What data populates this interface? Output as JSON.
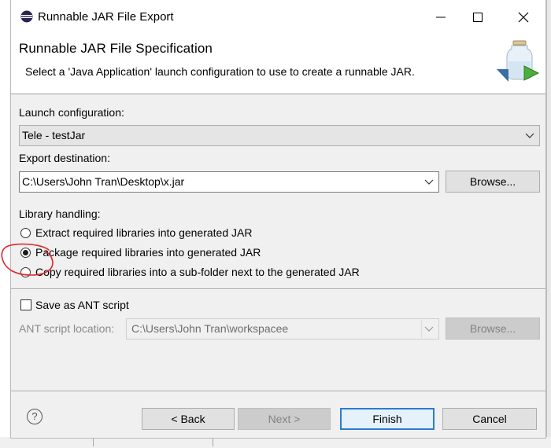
{
  "window": {
    "title": "Runnable JAR File Export"
  },
  "banner": {
    "title": "Runnable JAR File Specification",
    "description": "Select a 'Java Application' launch configuration to use to create a runnable JAR."
  },
  "launch": {
    "label": "Launch configuration:",
    "value": "Tele - testJar"
  },
  "export": {
    "label": "Export destination:",
    "value": "C:\\Users\\John Tran\\Desktop\\x.jar",
    "browse_label": "Browse..."
  },
  "library": {
    "label": "Library handling:",
    "options": [
      {
        "label": "Extract required libraries into generated JAR",
        "selected": false
      },
      {
        "label": "Package required libraries into generated JAR",
        "selected": true
      },
      {
        "label": "Copy required libraries into a sub-folder next to the generated JAR",
        "selected": false
      }
    ]
  },
  "ant": {
    "checkbox_label": "Save as ANT script",
    "checked": false,
    "location_label": "ANT script location:",
    "location_value": "C:\\Users\\John Tran\\workspacee",
    "browse_label": "Browse...",
    "enabled": false
  },
  "footer": {
    "help_icon": "question-mark-icon",
    "back_label": "< Back",
    "next_label": "Next >",
    "finish_label": "Finish",
    "cancel_label": "Cancel"
  },
  "colors": {
    "accent": "#2b7bd5",
    "annotation": "#e0242a"
  }
}
